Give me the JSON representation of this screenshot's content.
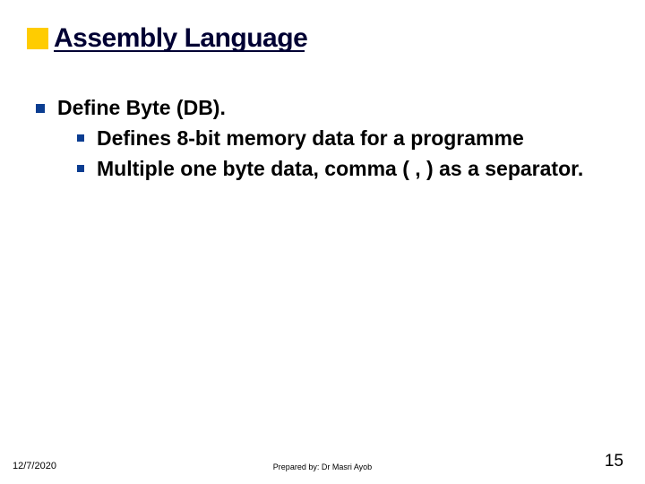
{
  "title": "Assembly Language",
  "bullets": {
    "lvl1": "Define Byte (DB).",
    "lvl2a": "Defines 8-bit memory data for a programme",
    "lvl2b": "Multiple one byte data, comma ( , ) as a separator."
  },
  "footer": {
    "date": "12/7/2020",
    "center": "Prepared by: Dr Masri Ayob",
    "page": "15"
  }
}
